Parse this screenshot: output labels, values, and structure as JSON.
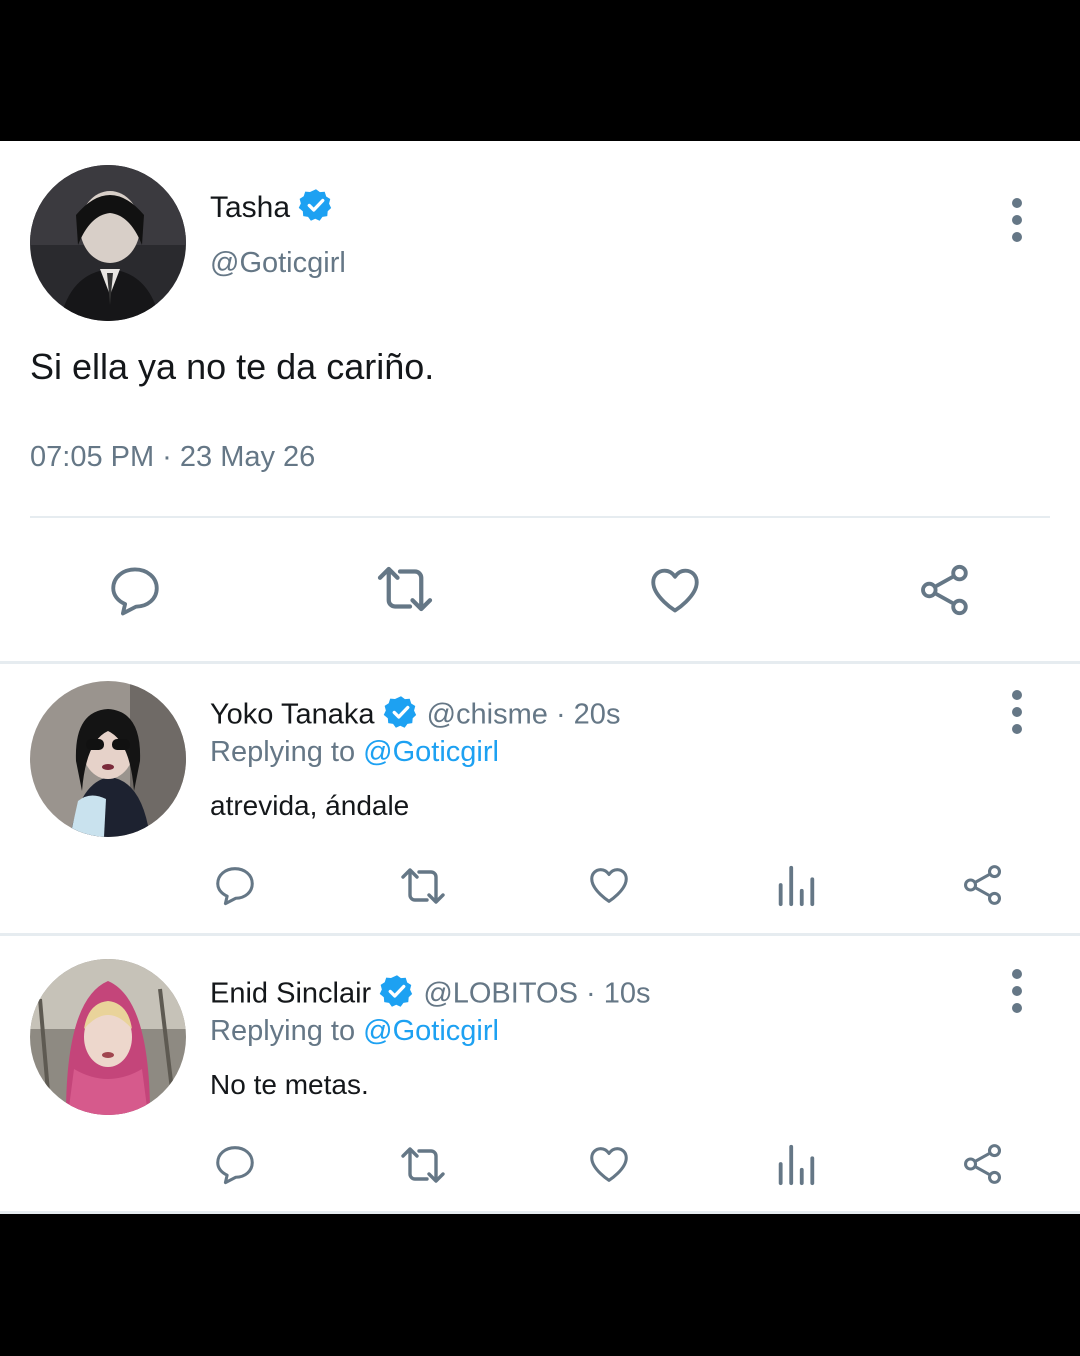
{
  "main_tweet": {
    "name": "Tasha",
    "handle": "@Goticgirl",
    "text": "Si ella ya no te da cariño.",
    "timestamp": "07:05 PM · 23 May 26",
    "verified": true
  },
  "replies": [
    {
      "name": "Yoko Tanaka",
      "handle": "@chisme",
      "time": "· 20s",
      "replying_prefix": "Replying to",
      "replying_to": "@Goticgirl",
      "text": "atrevida, ándale",
      "verified": true
    },
    {
      "name": "Enid Sinclair",
      "handle": "@LOBITOS",
      "time": "· 10s",
      "replying_prefix": "Replying to",
      "replying_to": "@Goticgirl",
      "text": "No te metas.",
      "verified": true
    }
  ],
  "icons": {
    "reply": "comment-icon",
    "retweet": "retweet-icon",
    "like": "heart-icon",
    "share": "share-icon",
    "analytics": "analytics-icon",
    "more": "more-vertical-icon",
    "verified": "verified-badge-icon"
  },
  "colors": {
    "text_primary": "#14171a",
    "text_secondary": "#657786",
    "mention_blue": "#1da1f2",
    "verified_blue": "#1da1f2",
    "background": "#ffffff"
  }
}
